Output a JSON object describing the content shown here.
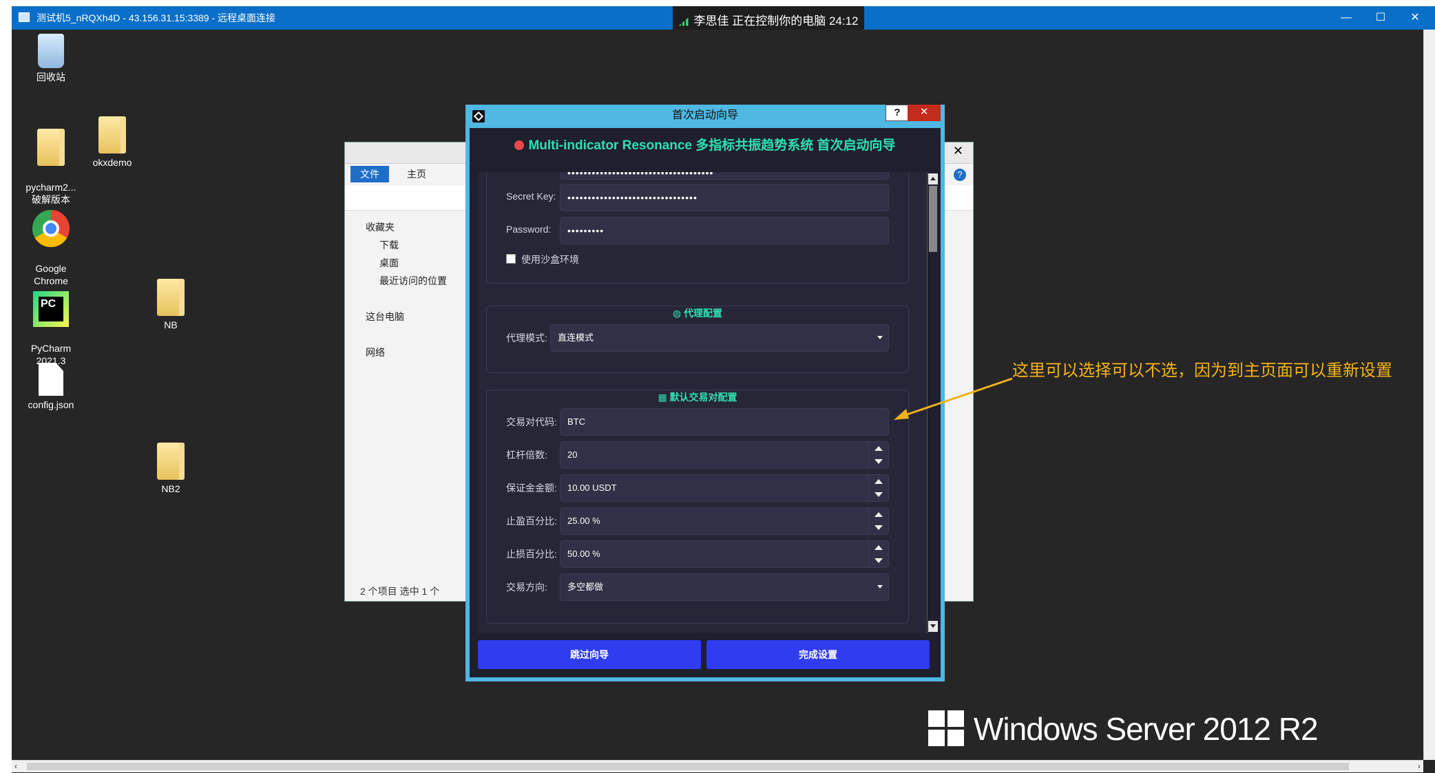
{
  "rdp": {
    "title": "测试机5_nRQXh4D - 43.156.31.15:3389 - 远程桌面连接",
    "controls": [
      "—",
      "☐",
      "✕"
    ],
    "remote_notice": "李思佳 正在控制你的电脑 24:12"
  },
  "desktop_icons": [
    {
      "label": "回收站",
      "icon": "recycle-bin-icon"
    },
    {
      "label": "pycharm2...\n破解版本",
      "icon": "folder-icon"
    },
    {
      "label": "okxdemo",
      "icon": "folder-icon"
    },
    {
      "label": "Google\nChrome",
      "icon": "chrome-icon"
    },
    {
      "label": "PyCharm\n2021.3",
      "icon": "pycharm-icon"
    },
    {
      "label": "NB",
      "icon": "folder-icon"
    },
    {
      "label": "config.json",
      "icon": "file-icon"
    },
    {
      "label": "NB2",
      "icon": "folder-icon"
    }
  ],
  "explorer": {
    "tab_file": "文件",
    "tab_home": "主页",
    "side_items": [
      "收藏夹",
      "下载",
      "桌面",
      "最近访问的位置",
      "这台电脑",
      "网络"
    ],
    "status": "2 个项目    选中 1 个",
    "close": "✕",
    "help": "?"
  },
  "wizard": {
    "title": "首次启动向导",
    "help": "?",
    "close": "✕",
    "heading": "Multi-indicator Resonance 多指标共振趋势系统 首次启动向导",
    "api": {
      "secret_key_label": "Secret Key:",
      "secret_key_value": "••••••••••••••••••••••••••••••••",
      "password_label": "Password:",
      "password_value": "•••••••••",
      "sandbox_label": "使用沙盒环境",
      "partial_top_value": "••••••••••••••••••••••••••••••••••••"
    },
    "proxy": {
      "title": "代理配置",
      "mode_label": "代理模式:",
      "mode_value": "直连模式"
    },
    "trade": {
      "title": "默认交易对配置",
      "symbol_label": "交易对代码:",
      "symbol_value": "BTC",
      "leverage_label": "杠杆倍数:",
      "leverage_value": "20",
      "margin_label": "保证金金额:",
      "margin_value": "10.00 USDT",
      "tp_label": "止盈百分比:",
      "tp_value": "25.00 %",
      "sl_label": "止损百分比:",
      "sl_value": "50.00 %",
      "direction_label": "交易方向:",
      "direction_value": "多空都做"
    },
    "skip_button": "跳过向导",
    "finish_button": "完成设置"
  },
  "annotation": "这里可以选择可以不选，因为到主页面可以重新设置",
  "branding": "Windows Server 2012 R2",
  "colors": {
    "accent": "#2fe0b0",
    "button": "#2f3cf0",
    "annotation": "#f3b21a",
    "titlebar": "#0a6fc8"
  }
}
